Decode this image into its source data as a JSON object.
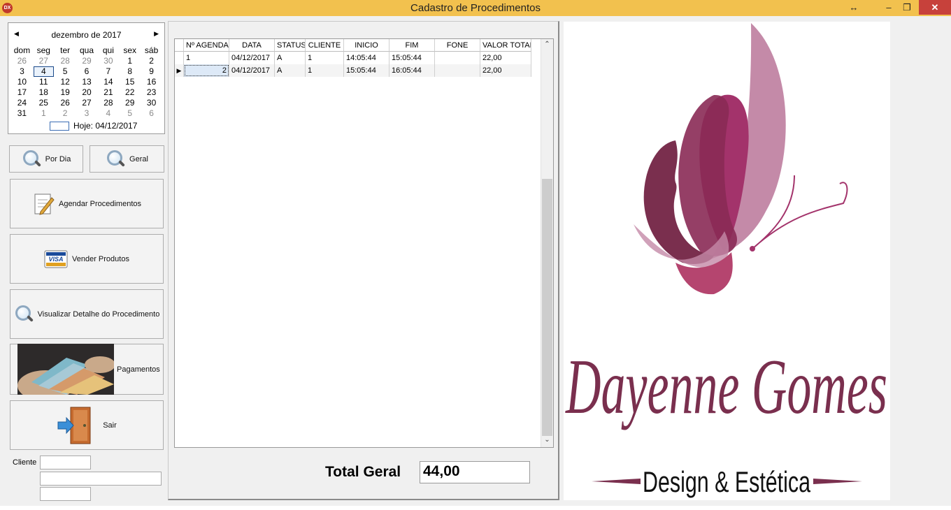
{
  "window": {
    "title": "Cadastro de Procedimentos",
    "app_icon": "DX"
  },
  "calendar": {
    "month_label": "dezembro de 2017",
    "weekdays": [
      "dom",
      "seg",
      "ter",
      "qua",
      "qui",
      "sex",
      "sáb"
    ],
    "weeks": [
      [
        "26",
        "27",
        "28",
        "29",
        "30",
        "1",
        "2"
      ],
      [
        "3",
        "4",
        "5",
        "6",
        "7",
        "8",
        "9"
      ],
      [
        "10",
        "11",
        "12",
        "13",
        "14",
        "15",
        "16"
      ],
      [
        "17",
        "18",
        "19",
        "20",
        "21",
        "22",
        "23"
      ],
      [
        "24",
        "25",
        "26",
        "27",
        "28",
        "29",
        "30"
      ],
      [
        "31",
        "1",
        "2",
        "3",
        "4",
        "5",
        "6"
      ]
    ],
    "today_label": "Hoje: 04/12/2017"
  },
  "buttons": {
    "por_dia": "Por Dia",
    "geral": "Geral",
    "agendar": "Agendar Procedimentos",
    "vender": "Vender Produtos",
    "visa": "VISA",
    "visualizar": "Visualizar Detalhe do Procedimento",
    "pagamentos": "Pagamentos",
    "sair": "Sair"
  },
  "form": {
    "cliente_label": "Cliente"
  },
  "grid": {
    "columns": [
      "Nº AGENDA",
      "DATA",
      "STATUS",
      "CLIENTE",
      "INICIO",
      "FIM",
      "FONE",
      "VALOR TOTAL"
    ],
    "rows": [
      [
        "1",
        "04/12/2017",
        "A",
        "1",
        "14:05:44",
        "15:05:44",
        "",
        "22,00"
      ],
      [
        "2",
        "04/12/2017",
        "A",
        "1",
        "15:05:44",
        "16:05:44",
        "",
        "22,00"
      ]
    ]
  },
  "total": {
    "label": "Total Geral",
    "value": "44,00"
  },
  "logo": {
    "name": "Dayenne Gomes",
    "tagline": "Design & Estética"
  },
  "colors": {
    "titlebar": "#f2c14e",
    "close": "#c7413b",
    "logo_text": "#7a2f4e",
    "logo_pink": "#a3336b"
  }
}
